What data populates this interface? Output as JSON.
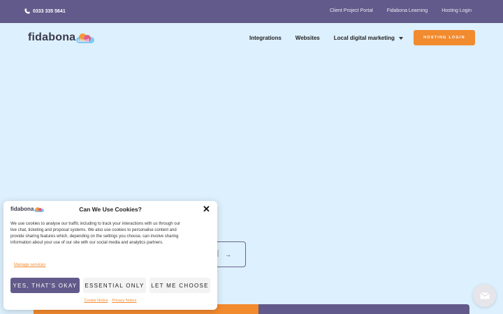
{
  "topbar": {
    "phone": "0333 335 5641",
    "links": [
      "Client Project Portal",
      "Fidabona Learning",
      "Hosting Login"
    ]
  },
  "nav": {
    "logo_text": "fidabona",
    "logo_badge": "cloud",
    "items": [
      "Integrations",
      "Websites",
      "Local digital marketing"
    ],
    "login_button": "HOSTING LOGIN"
  },
  "cookie": {
    "logo_text": "fidabona",
    "title": "Can We Use Cookies?",
    "body": "We use cookies to analyse our traffic including to track your interactions with us through our live chat, ticketing and proposal systems. We also use cookies to personalise content and provide sharing features which, depending on the settings you choose, can involve sharing information about your use of our site with our social media and analytics partners.",
    "manage": "Manage services",
    "btn_yes": "YES, THAT'S OKAY",
    "btn_essential": "ESSENTIAL ONLY",
    "btn_choose": "LET ME CHOOSE",
    "cookie_notice": "Cookie Notice",
    "privacy_notice": "Privacy Notice"
  },
  "colors": {
    "purple": "#625a8a",
    "orange": "#f28a2e",
    "background": "#ddf0fd"
  }
}
